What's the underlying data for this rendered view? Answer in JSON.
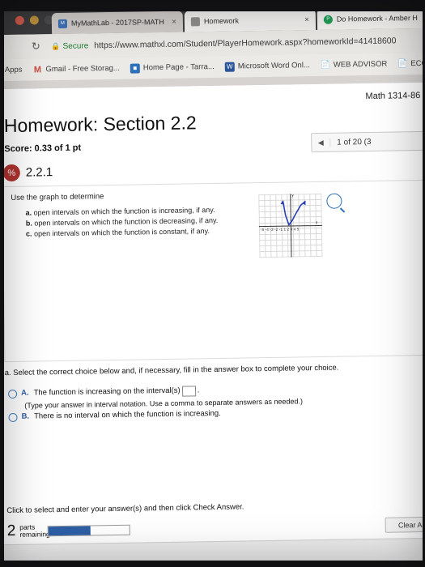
{
  "browser": {
    "tabs": [
      {
        "title": "MyMathLab - 2017SP-MATH",
        "close": "×",
        "favicon": "mymathlab-icon"
      },
      {
        "title": "Homework",
        "close": "×",
        "favicon": "homework-icon"
      },
      {
        "title": "Do Homework - Amber H",
        "close": "",
        "favicon": "pearson-icon"
      }
    ],
    "reload_icon": "↻",
    "secure_label": "Secure",
    "lock_icon": "🔒",
    "url": "https://www.mathxl.com/Student/PlayerHomework.aspx?homeworkId=41418600",
    "bookmarks": [
      {
        "label": "Apps",
        "icon": "apps-grid-icon"
      },
      {
        "label": "Gmail - Free Storag...",
        "icon": "gmail-icon"
      },
      {
        "label": "Home Page - Tarra...",
        "icon": "homepage-icon"
      },
      {
        "label": "Microsoft Word Onl...",
        "icon": "word-icon"
      },
      {
        "label": "WEB ADVISOR",
        "icon": "document-icon"
      },
      {
        "label": "ECON",
        "icon": "document-icon"
      }
    ]
  },
  "page": {
    "course_line": "Math 1314-86",
    "title": "Homework: Section 2.2",
    "score": "Score: 0.33 of 1 pt",
    "pager": {
      "prev_arrow": "◀",
      "text": "1 of 20 (3"
    },
    "question_number": "2.2.1",
    "question_badge_icon": "percent-score-icon",
    "prompt": "Use the graph to determine",
    "subparts": [
      {
        "label": "a.",
        "text": "open intervals on which the function is increasing, if any."
      },
      {
        "label": "b.",
        "text": "open intervals on which the function is decreasing, if any."
      },
      {
        "label": "c.",
        "text": "open intervals on which the function is constant, if any."
      }
    ],
    "graph": {
      "x_axis_label": "x",
      "y_axis_label": "y",
      "x_ticks": "-5 -4 -3 -2 -1    1  2  3  4  5",
      "y_ticks_pos": "5\n4\n3\n2\n1",
      "y_ticks_neg": "-2\n-3\n-4\n-5"
    },
    "magnify_icon": "magnifier-icon",
    "part_question": "a. Select the correct choice below and, if necessary, fill in the answer box to complete your choice.",
    "choices": [
      {
        "letter": "A.",
        "text": "The function is increasing on the interval(s)",
        "has_input": true,
        "input_value": "",
        "trailing": "."
      },
      {
        "letter": "B.",
        "text": "There is no interval on which the function is increasing.",
        "has_input": false
      }
    ],
    "choice_hint": "(Type your answer in interval notation. Use a comma to separate answers as needed.)",
    "bottom_note": "Click to select and enter your answer(s) and then click Check Answer.",
    "parts_count": "2",
    "parts_label_line1": "parts",
    "parts_label_line2": "remaining",
    "clear_button": "Clear A"
  }
}
